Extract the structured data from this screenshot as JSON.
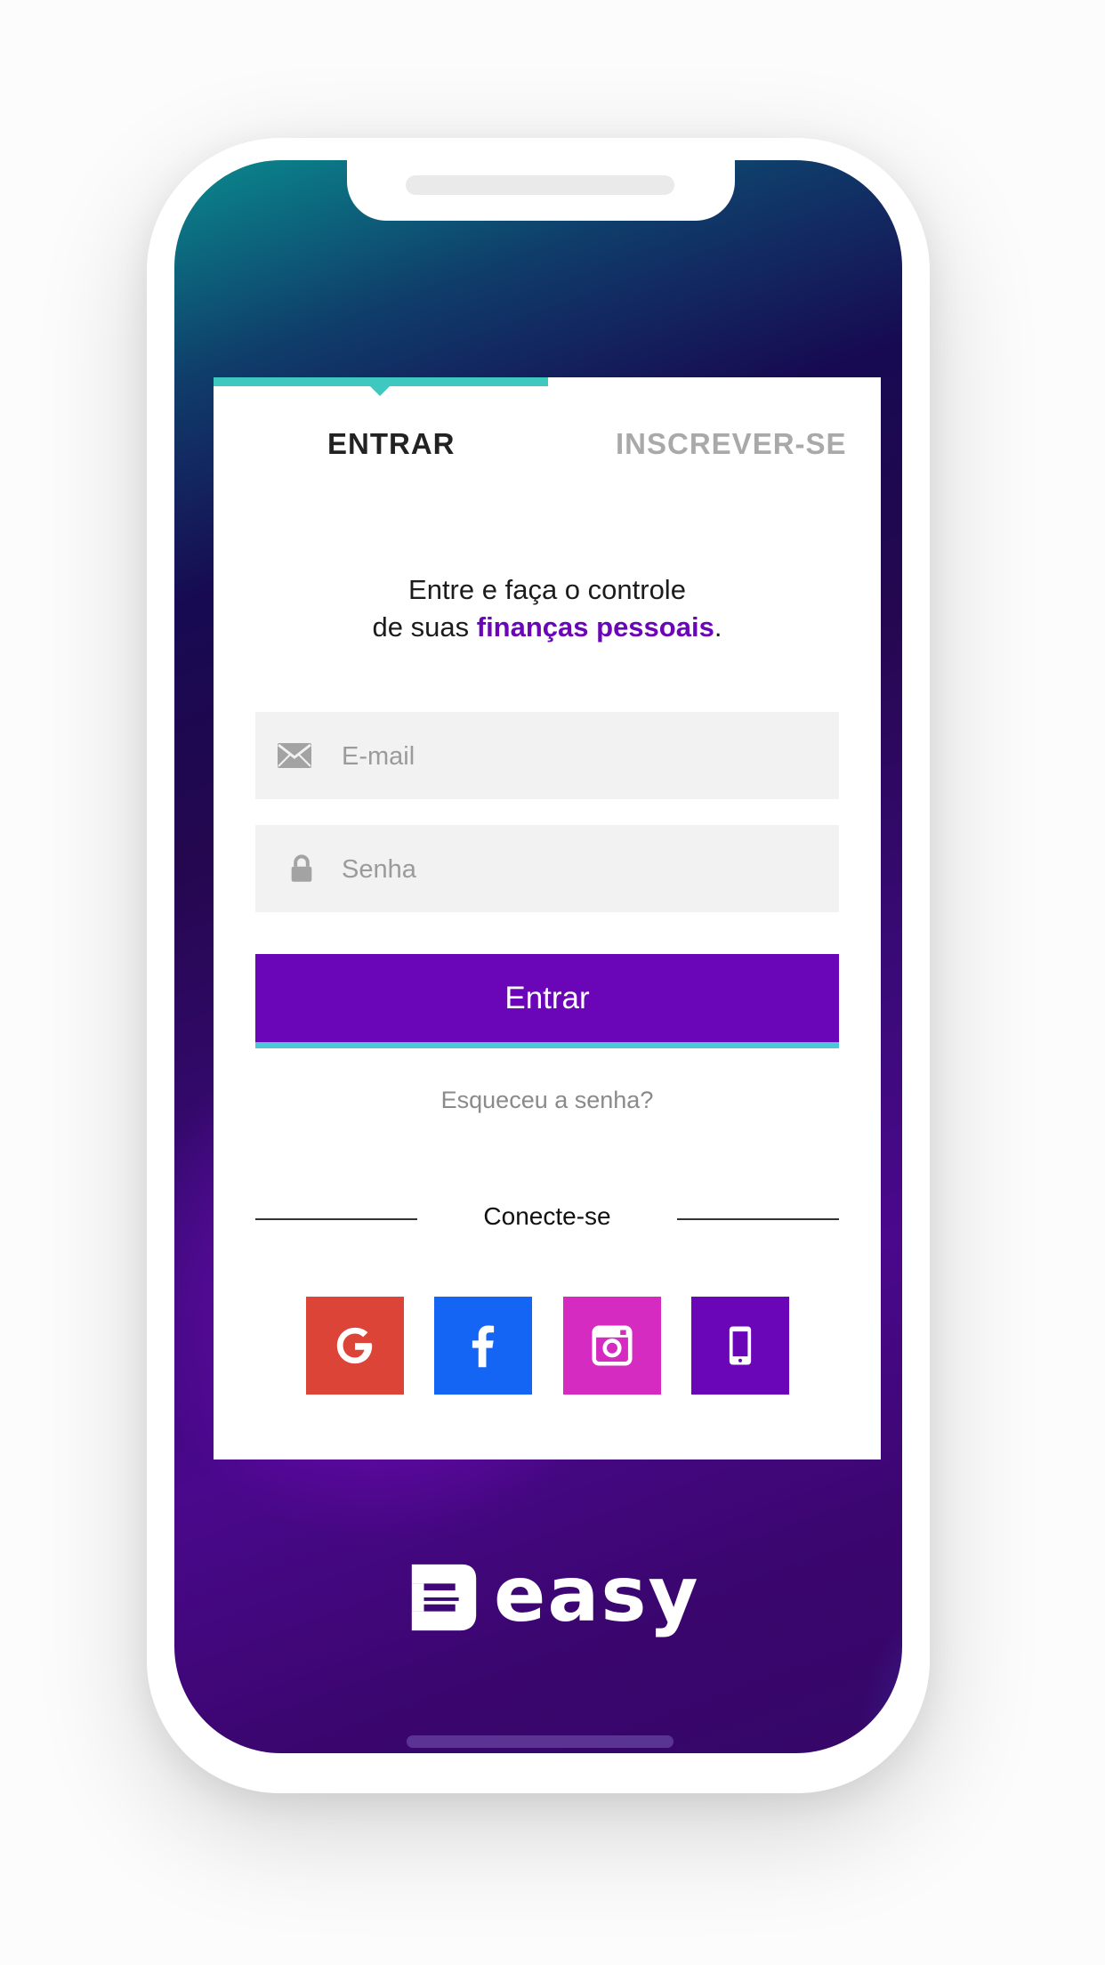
{
  "tabs": {
    "login": "ENTRAR",
    "signup": "INSCREVER-SE",
    "active": "login"
  },
  "tagline": {
    "line1": "Entre e faça o controle",
    "line2_prefix": "de suas ",
    "line2_highlight": "finanças pessoais",
    "line2_suffix": "."
  },
  "form": {
    "email_placeholder": "E-mail",
    "email_value": "",
    "password_placeholder": "Senha",
    "password_value": "",
    "submit_label": "Entrar",
    "forgot_label": "Esqueceu a senha?"
  },
  "social": {
    "label": "Conecte-se",
    "buttons": [
      {
        "name": "google",
        "icon": "google-icon",
        "color": "#db4437"
      },
      {
        "name": "facebook",
        "icon": "facebook-icon",
        "color": "#1565f5"
      },
      {
        "name": "instagram",
        "icon": "instagram-icon",
        "color": "#d52bc0"
      },
      {
        "name": "phone",
        "icon": "mobile-phone-icon",
        "color": "#6a06b8"
      }
    ]
  },
  "brand": {
    "name": "easy"
  },
  "colors": {
    "primary": "#6a06b8",
    "accent": "#3fc8c0",
    "button_underline": "#4fc6d8"
  }
}
